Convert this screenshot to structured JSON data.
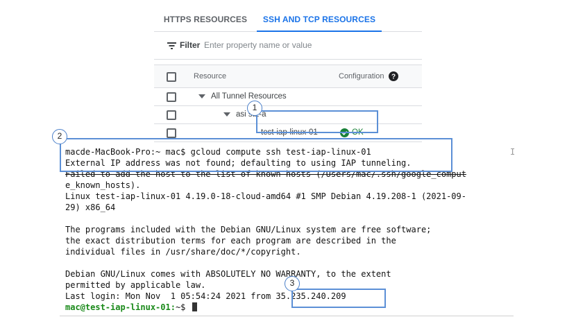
{
  "tabs": [
    {
      "label": "HTTPS RESOURCES",
      "active": false
    },
    {
      "label": "SSH AND TCP RESOURCES",
      "active": true
    }
  ],
  "filter": {
    "label": "Filter",
    "placeholder": "Enter property name or value",
    "icon": "filter-icon"
  },
  "table": {
    "headers": {
      "resource": "Resource",
      "configuration": "Configuration"
    },
    "rows": [
      {
        "label": "All Tunnel Resources",
        "level": 0
      },
      {
        "label": "asi   st1-a",
        "level": 1
      },
      {
        "label": "test-iap-linux-01",
        "level": 2,
        "status": "OK"
      }
    ]
  },
  "terminal": {
    "lines": [
      "macde-MacBook-Pro:~ mac$ gcloud compute ssh test-iap-linux-01",
      "External IP address was not found; defaulting to using IAP tunneling.",
      "Failed to add the host to the list of known hosts (/Users/mac/.ssh/google_comput",
      "e_known_hosts).",
      "Linux test-iap-linux-01 4.19.0-18-cloud-amd64 #1 SMP Debian 4.19.208-1 (2021-09-",
      "29) x86_64",
      "",
      "The programs included with the Debian GNU/Linux system are free software;",
      "the exact distribution terms for each program are described in the",
      "individual files in /usr/share/doc/*/copyright.",
      "",
      "Debian GNU/Linux comes with ABSOLUTELY NO WARRANTY, to the extent",
      "permitted by applicable law.",
      "Last login: Mon Nov  1 05:54:24 2021 from 35.235.240.209"
    ],
    "prompt_user": "mac@test-iap-linux-01:",
    "prompt_rest": "~$ "
  },
  "callouts": [
    "1",
    "2",
    "3"
  ],
  "colors": {
    "accent": "#1a73e8",
    "callout": "#5b8fd6",
    "ok": "#188038",
    "prompt": "#1a8a1a"
  }
}
